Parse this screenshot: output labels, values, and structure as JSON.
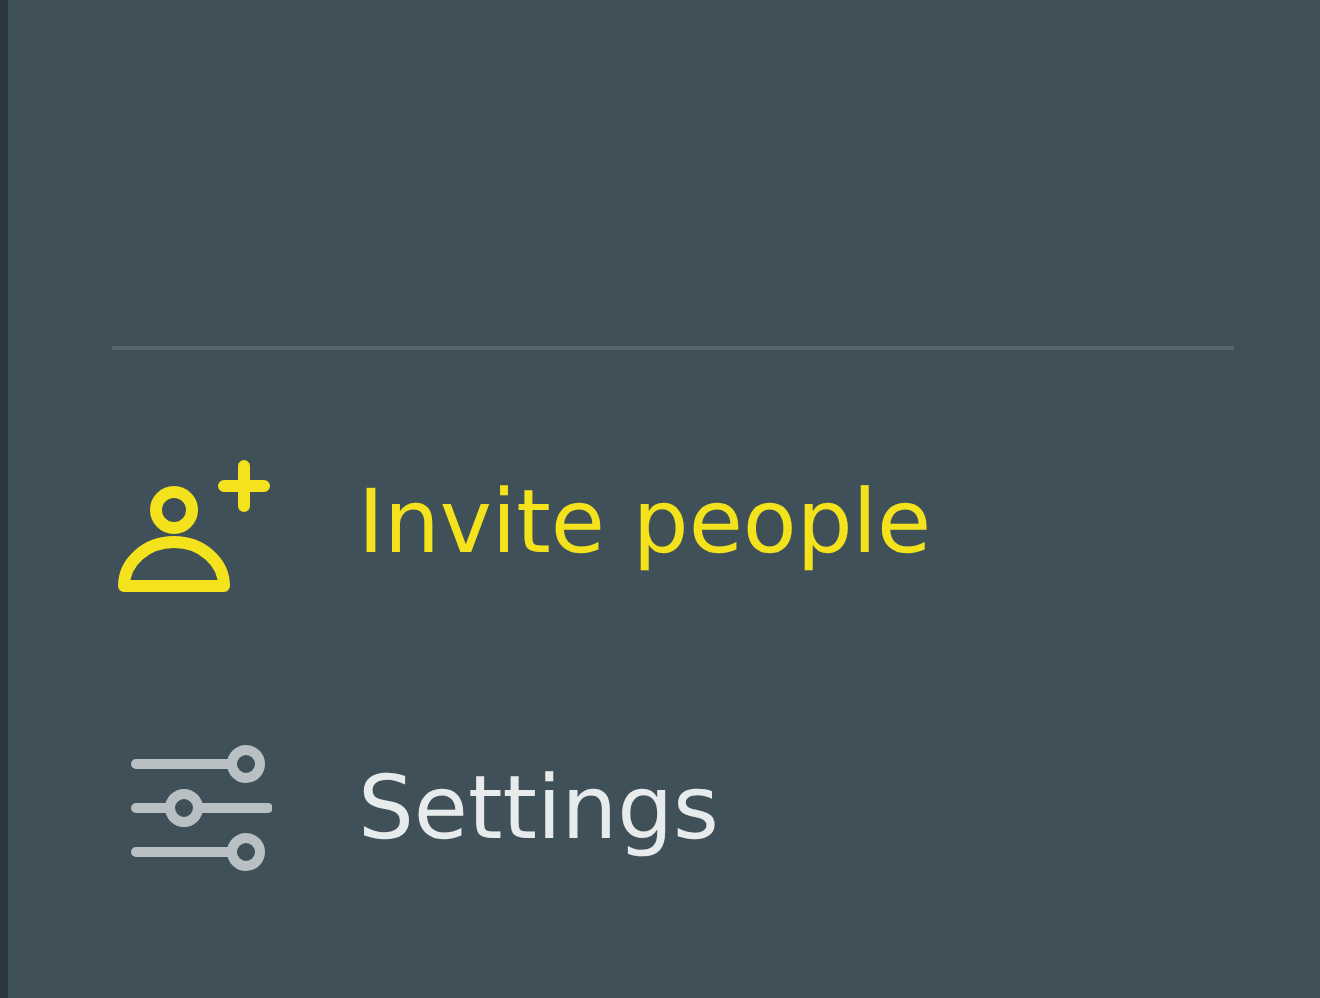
{
  "menu": {
    "items": [
      {
        "kind": "invite",
        "label": "Invite people",
        "selected": true
      },
      {
        "kind": "settings",
        "label": "Settings",
        "selected": false
      }
    ]
  }
}
